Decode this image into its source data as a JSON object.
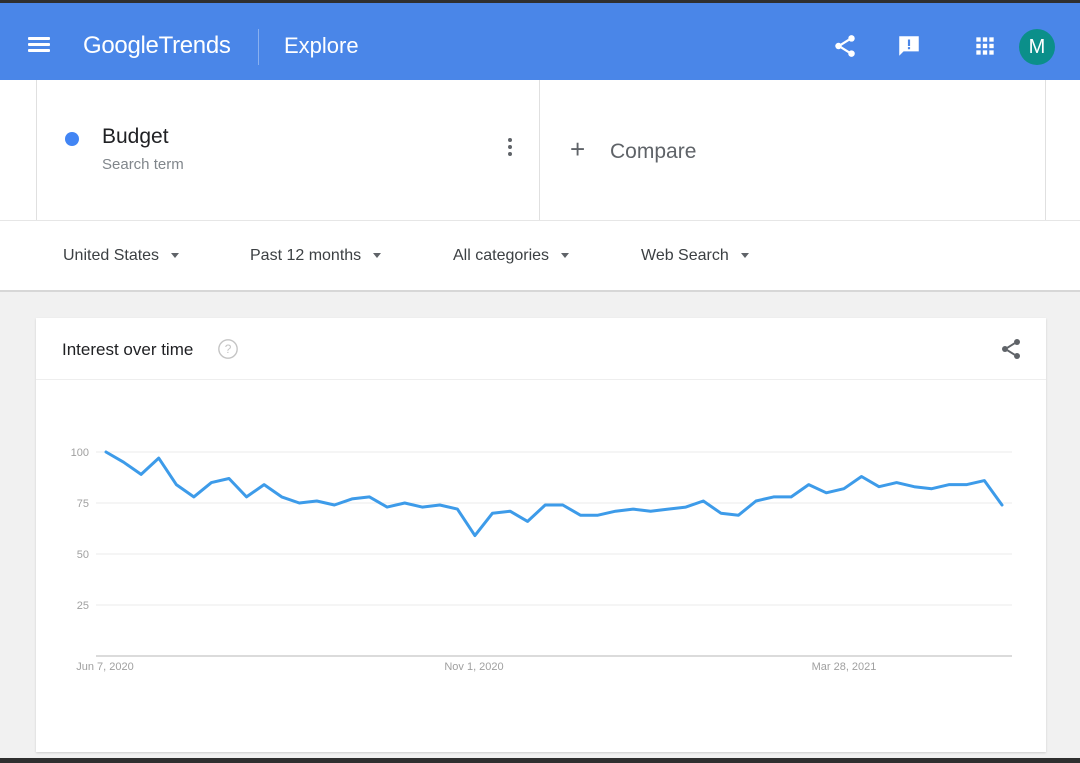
{
  "header": {
    "logo_google": "Google",
    "logo_trends": "Trends",
    "page": "Explore",
    "avatar_initial": "M",
    "icons": [
      "menu-icon",
      "share-icon",
      "feedback-icon",
      "apps-icon"
    ]
  },
  "term": {
    "name": "Budget",
    "type": "Search term",
    "color": "#4285f4"
  },
  "compare": {
    "label": "Compare"
  },
  "filters": {
    "region": "United States",
    "time": "Past 12 months",
    "category": "All categories",
    "property": "Web Search"
  },
  "chart": {
    "title": "Interest over time"
  },
  "chart_data": {
    "type": "line",
    "title": "Interest over time",
    "y_ticks": [
      "100",
      "75",
      "50",
      "25"
    ],
    "ylim": [
      0,
      100
    ],
    "x_tick_labels": [
      "Jun 7, 2020",
      "Nov 1, 2020",
      "Mar 28, 2021"
    ],
    "series": [
      {
        "color": "#3d9be9",
        "values": [
          100,
          95,
          89,
          97,
          84,
          78,
          85,
          87,
          78,
          84,
          78,
          75,
          76,
          74,
          77,
          78,
          73,
          75,
          73,
          74,
          72,
          59,
          70,
          71,
          66,
          74,
          74,
          69,
          69,
          71,
          72,
          71,
          72,
          73,
          76,
          70,
          69,
          76,
          78,
          78,
          84,
          80,
          82,
          88,
          83,
          85,
          83,
          82,
          84,
          84,
          86,
          74
        ]
      }
    ],
    "grid": true
  }
}
